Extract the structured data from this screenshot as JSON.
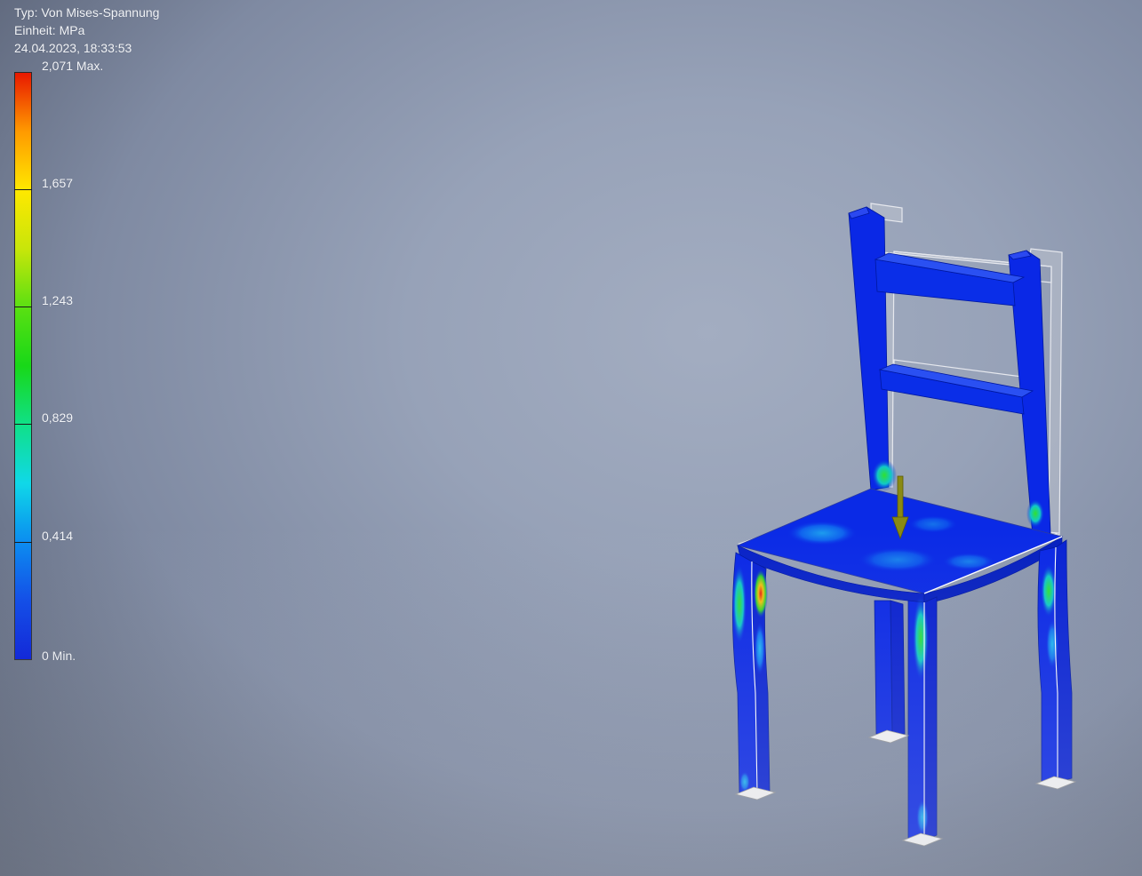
{
  "info": {
    "type": "Typ: Von Mises-Spannung",
    "unit": "Einheit: MPa",
    "timestamp": "24.04.2023, 18:33:53"
  },
  "legend": {
    "labels": {
      "max": "2,071 Max.",
      "v1657": "1,657",
      "v1243": "1,243",
      "v0829": "0,829",
      "v0414": "0,414",
      "min": "0 Min."
    },
    "colors": {
      "low": "#0018d8",
      "mid": "#18d818",
      "high": "#e81800"
    }
  },
  "model": {
    "name_icon": "chair-stress-model",
    "load_arrow_color": "#8a8a12",
    "base_color": "#0a28e6",
    "undeformed_outline_color": "#d8dbe4"
  }
}
